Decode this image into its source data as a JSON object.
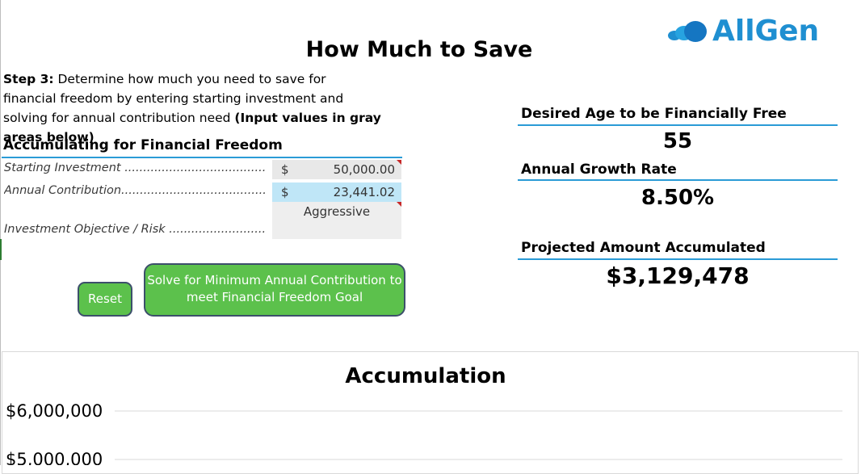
{
  "logo": {
    "text": "AllGen",
    "color": "#1f8fd1"
  },
  "page_title": "How Much to Save",
  "step": {
    "label": "Step 3:",
    "text": " Determine how much you need to save for financial freedom by entering starting investment and solving for annual contribution need ",
    "bold_note": "(Input values in gray areas below)"
  },
  "section": {
    "title": "Accumulating for Financial Freedom",
    "rows": [
      {
        "label": "Starting Investment ...............................................",
        "currency": "$",
        "value": "50,000.00"
      },
      {
        "label": "Annual Contribution..............................................",
        "currency": "$",
        "value": "23,441.02"
      }
    ],
    "risk": {
      "label": "Investment Objective / Risk .................................",
      "value": "Aggressive"
    }
  },
  "buttons": {
    "reset": "Reset",
    "solve": "Solve for Minimum Annual Contribution to meet Financial Freedom Goal"
  },
  "summary": {
    "age_label": "Desired Age to be Financially Free",
    "age_value": "55",
    "growth_label": "Annual Growth Rate",
    "growth_value": "8.50%",
    "projected_label": "Projected Amount Accumulated",
    "projected_value": "$3,129,478"
  },
  "colors": {
    "accent_rule": "#2a9bd6",
    "button_green": "#5cc14c",
    "input_highlight": "#bfe6f7",
    "input_gray": "#e8e8e8"
  },
  "chart_data": {
    "type": "line",
    "title": "Accumulation",
    "y_tick_labels": [
      "$6,000,000",
      "$5,000,000"
    ],
    "y_ticks": [
      6000000,
      5000000
    ],
    "ylim_visible": [
      5000000,
      6000000
    ],
    "grid": true,
    "series": []
  }
}
